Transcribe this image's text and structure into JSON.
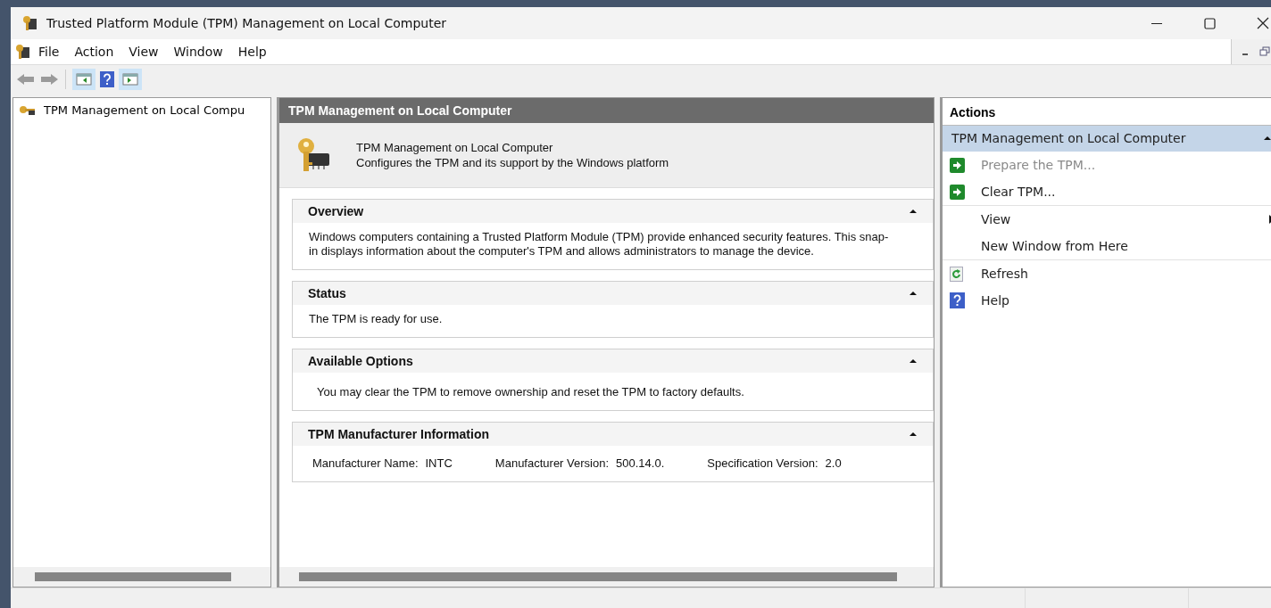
{
  "window": {
    "title": "Trusted Platform Module (TPM) Management on Local Computer"
  },
  "menu": [
    "File",
    "Action",
    "View",
    "Window",
    "Help"
  ],
  "tree": {
    "items": [
      {
        "label": "TPM Management on Local Compu",
        "selected": false
      }
    ]
  },
  "center": {
    "header": "TPM Management on Local Computer",
    "intro": {
      "title": "TPM Management on Local Computer",
      "description": "Configures the TPM and its support by the Windows platform"
    },
    "sections": [
      {
        "title": "Overview",
        "expanded": true,
        "kind": "text",
        "text": "Windows computers containing a Trusted Platform Module (TPM) provide enhanced security features. This snap-in displays information about the computer's TPM and allows administrators to manage the device."
      },
      {
        "title": "Status",
        "expanded": true,
        "kind": "text",
        "text": "The TPM is ready for use."
      },
      {
        "title": "Available Options",
        "expanded": true,
        "kind": "indented",
        "text": "You may clear the TPM to remove ownership and reset the TPM to factory defaults."
      },
      {
        "title": "TPM Manufacturer Information",
        "expanded": true,
        "kind": "fields",
        "fields": [
          {
            "label": "Manufacturer Name:",
            "value": "INTC"
          },
          {
            "label": "Manufacturer Version:",
            "value": "500.14.0."
          },
          {
            "label": "Specification Version:",
            "value": "2.0"
          }
        ]
      }
    ]
  },
  "actions": {
    "title": "Actions",
    "group": {
      "title": "TPM Management on Local Computer",
      "expanded": true
    },
    "groups": [
      [
        {
          "label": "Prepare the TPM...",
          "kind": "run",
          "disabled": true
        },
        {
          "label": "Clear TPM...",
          "kind": "run",
          "disabled": false
        }
      ],
      [
        {
          "label": "View",
          "kind": "submenu",
          "disabled": false
        },
        {
          "label": "New Window from Here",
          "kind": "plain",
          "disabled": false
        }
      ],
      [
        {
          "label": "Refresh",
          "kind": "refresh",
          "disabled": false
        },
        {
          "label": "Help",
          "kind": "help",
          "disabled": false
        }
      ]
    ]
  }
}
